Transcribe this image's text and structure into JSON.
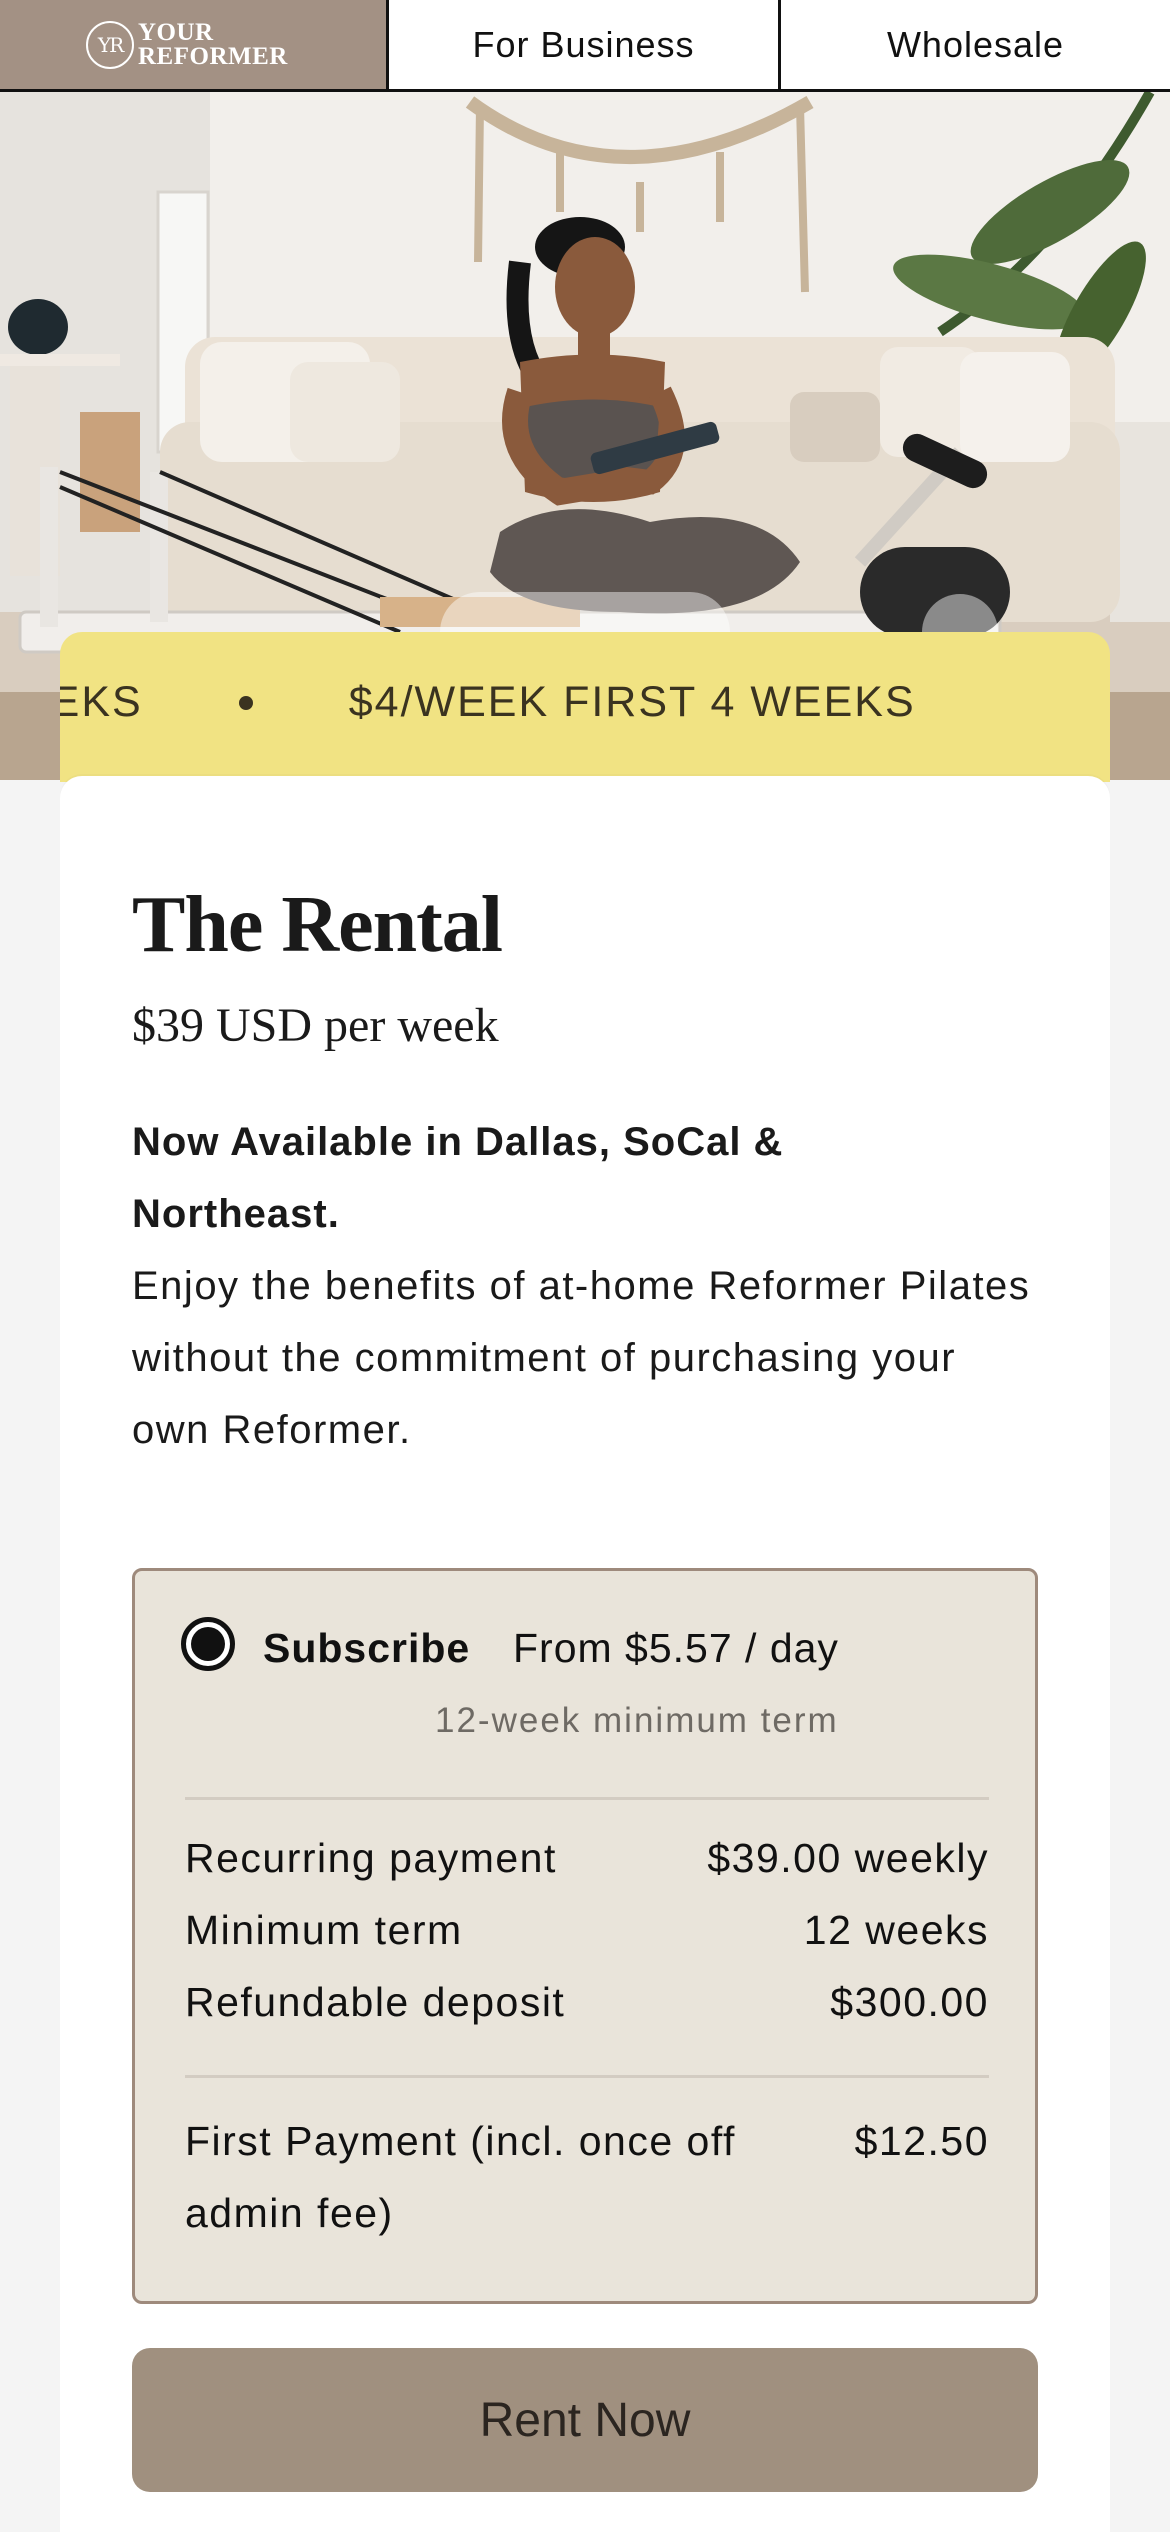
{
  "nav": {
    "logo_mark": "YR",
    "logo_line1": "YOUR",
    "logo_line2": "REFORMER",
    "tabs": [
      {
        "label": "For Business"
      },
      {
        "label": "Wholesale"
      }
    ]
  },
  "ticker": {
    "fragment": "EEKS",
    "message": "$4/WEEK FIRST 4 WEEKS"
  },
  "product": {
    "title": "The Rental",
    "price": "$39 USD per week",
    "availability": "Now Available in Dallas, SoCal & Northeast.",
    "description": "Enjoy the benefits of at-home Reformer Pilates without the commitment of purchasing your own Reformer."
  },
  "plan": {
    "name": "Subscribe",
    "from_price": "From $5.57 / day",
    "term_note": "12-week minimum term",
    "rows": [
      {
        "label": "Recurring payment",
        "value": "$39.00 weekly"
      },
      {
        "label": "Minimum term",
        "value": "12 weeks"
      },
      {
        "label": "Refundable deposit",
        "value": "$300.00"
      }
    ],
    "first_payment_label": "First Payment (incl. once off admin fee)",
    "first_payment_value": "$12.50"
  },
  "cta": {
    "label": "Rent Now"
  },
  "colors": {
    "nav_brand": "#a39184",
    "ticker_bg": "#f1e383",
    "plan_bg": "#e9e4da",
    "plan_border": "#9e8a7c",
    "button_bg": "#a0907f"
  }
}
